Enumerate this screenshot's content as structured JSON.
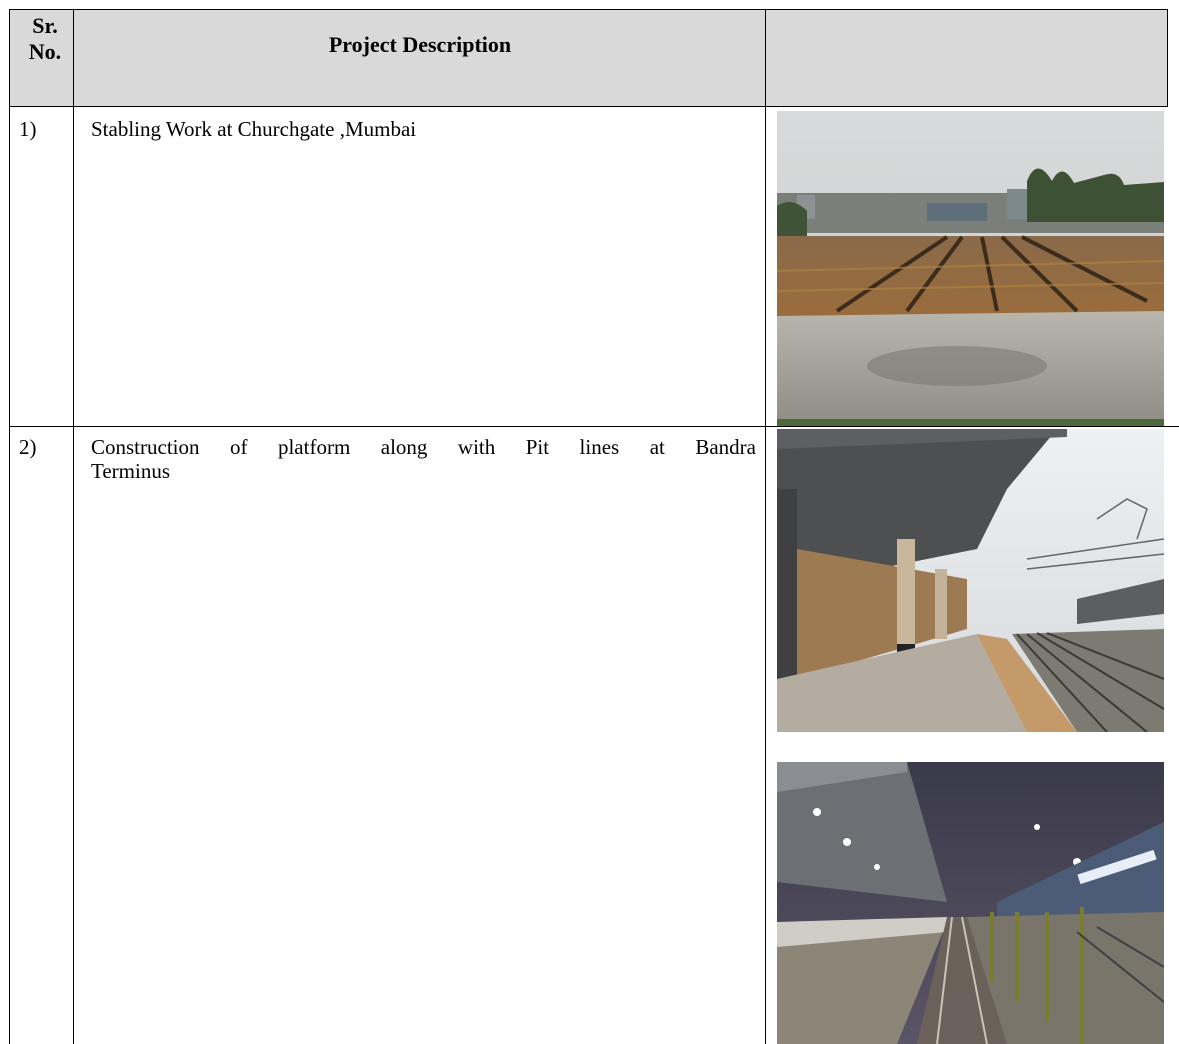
{
  "table": {
    "header": {
      "sr_no": "Sr.\nNo.",
      "sr_no_line1": "Sr.",
      "sr_no_line2": "No.",
      "description": "Project Description",
      "image_col": ""
    },
    "rows": [
      {
        "sr": "1)",
        "description": "Stabling Work at Churchgate ,Mumbai",
        "images": [
          "photo-construction-stabling-yard"
        ]
      },
      {
        "sr": "2)",
        "description_line1": "Construction of platform along with Pit lines at Bandra",
        "description_line2": "Terminus",
        "images": [
          "photo-platform-daytime",
          "photo-platform-night"
        ]
      }
    ]
  },
  "colors": {
    "header_bg": "#d9d9d9",
    "border": "#000000"
  }
}
